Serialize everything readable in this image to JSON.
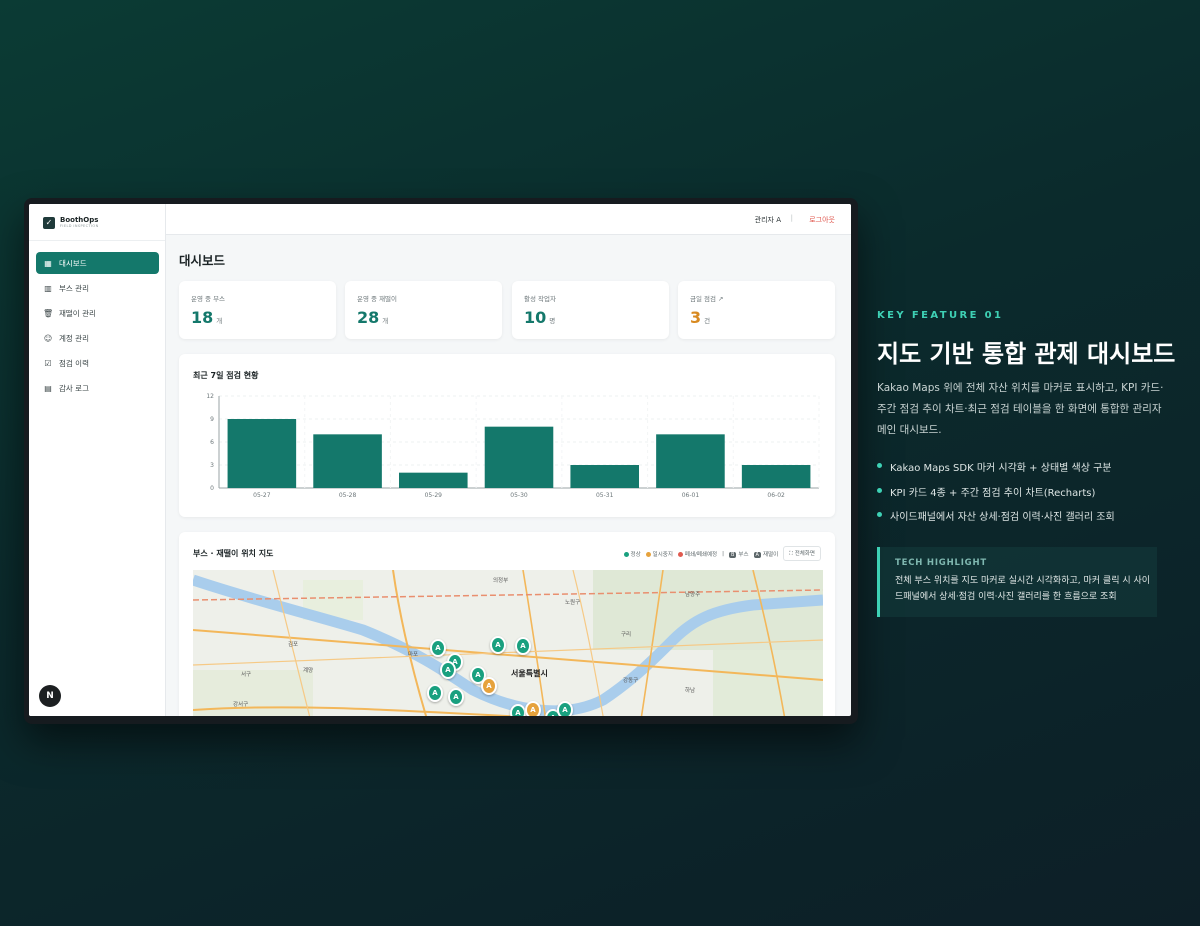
{
  "app": {
    "brand": "BoothOps",
    "brand_sub": "FIELD INSPECTION",
    "avatar_letter": "N"
  },
  "sidebar": {
    "items": [
      {
        "label": "대시보드",
        "icon": "grid-icon",
        "active": true
      },
      {
        "label": "부스 관리",
        "icon": "building-icon"
      },
      {
        "label": "재떨이 관리",
        "icon": "trash-icon"
      },
      {
        "label": "계정 관리",
        "icon": "users-icon"
      },
      {
        "label": "점검 이력",
        "icon": "clipboard-check-icon"
      },
      {
        "label": "감사 로그",
        "icon": "log-icon"
      }
    ]
  },
  "header": {
    "user": "관리자 A",
    "separator": "|",
    "logout": "로그아웃"
  },
  "page": {
    "title": "대시보드"
  },
  "kpis": [
    {
      "label": "운영 중 부스",
      "value": "18",
      "unit": "개"
    },
    {
      "label": "운영 중 재떨이",
      "value": "28",
      "unit": "개"
    },
    {
      "label": "활성 작업자",
      "value": "10",
      "unit": "명"
    },
    {
      "label": "금일 점검 ↗",
      "value": "3",
      "unit": "건"
    }
  ],
  "chart_data": {
    "type": "bar",
    "title": "최근 7일 점검 현황",
    "categories": [
      "05-27",
      "05-28",
      "05-29",
      "05-30",
      "05-31",
      "06-01",
      "06-02"
    ],
    "values": [
      9,
      7,
      2,
      8,
      3,
      7,
      3
    ],
    "yticks": [
      "0",
      "3",
      "6",
      "9",
      "12"
    ],
    "ylim": [
      0,
      12
    ],
    "grid": true,
    "color": "#14786b"
  },
  "map_panel": {
    "title": "부스 · 재떨이 위치 지도",
    "legend": {
      "normal": "정상",
      "paused": "일시중지",
      "removed": "폐쇄/폐쇄예정",
      "sep": "|",
      "booth_chip": "B",
      "booth": "부스",
      "tray_chip": "A",
      "tray": "재떨이",
      "fullscreen": "전체화면"
    },
    "status_colors": {
      "normal": "#19a07f",
      "paused": "#e6a23c",
      "removed": "#e05a4f"
    },
    "labels": [
      "김포",
      "서구",
      "계양",
      "구리",
      "하남",
      "서울특별시",
      "노원구",
      "남양주",
      "의정부",
      "강동구",
      "마포",
      "용산",
      "강서구"
    ],
    "marker_letter": "A"
  },
  "feature": {
    "tag": "KEY FEATURE 01",
    "title": "지도 기반 통합 관제 대시보드",
    "desc": "Kakao Maps 위에 전체 자산 위치를 마커로 표시하고, KPI 카드·주간 점검 추이 차트·최근 점검 테이블을 한 화면에 통합한 관리자 메인 대시보드.",
    "bullets": [
      "Kakao Maps SDK 마커 시각화 + 상태별 색상 구분",
      "KPI 카드 4종 + 주간 점검 추이 차트(Recharts)",
      "사이드패널에서 자산 상세·점검 이력·사진 갤러리 조회"
    ],
    "highlight_title": "TECH HIGHLIGHT",
    "highlight_text": "전체 부스 위치를 지도 마커로 실시간 시각화하고, 마커 클릭 시 사이드패널에서 상세·점검 이력·사진 갤러리를 한 흐름으로 조회"
  }
}
